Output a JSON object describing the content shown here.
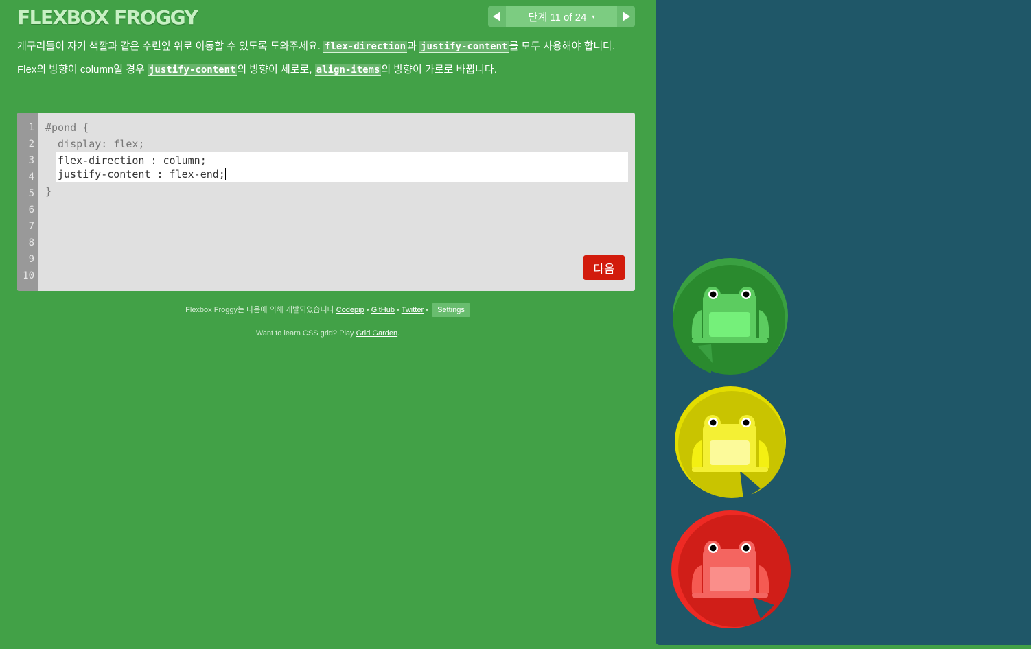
{
  "app": {
    "title": "FLEXBOX FROGGY"
  },
  "level_nav": {
    "label": "단계 11 of 24",
    "caret": "▾",
    "prev_icon": "triangle-left-icon",
    "next_icon": "triangle-right-icon"
  },
  "instructions": {
    "p1_a": "개구리들이 자기 색깔과 같은 수련잎 위로 이동할 수 있도록 도와주세요. ",
    "p1_code1": "flex-direction",
    "p1_b": "과 ",
    "p1_code2": "justify-content",
    "p1_c": "를 모두 사용해야 합니다.",
    "p2_a": "Flex의 방향이 column일 경우 ",
    "p2_code1": "justify-content",
    "p2_b": "의 방향이 세로로, ",
    "p2_code2": "align-items",
    "p2_c": "의 방향이 가로로 바뀝니다."
  },
  "editor": {
    "line_numbers": [
      "1",
      "2",
      "3",
      "4",
      "5",
      "6",
      "7",
      "8",
      "9",
      "10"
    ],
    "line1": "#pond {",
    "line2": "  display: flex;",
    "input_line1": "flex-direction : column;",
    "input_line2": "justify-content : flex-end;",
    "closing": "}",
    "next_button": "다음"
  },
  "credits": {
    "prefix": "Flexbox Froggy는 다음에 의해 개발되었습니다 ",
    "codepip": "Codepip",
    "sep": " • ",
    "github": "GitHub",
    "twitter": "Twitter",
    "settings": "Settings",
    "promo_prefix": "Want to learn CSS grid? Play ",
    "grid_garden": "Grid Garden",
    "promo_suffix": "."
  },
  "colors": {
    "background_green": "#42a147",
    "pond_blue": "#1f5768",
    "next_button_red": "#d21b0c",
    "green_pad": "#2a8a2e",
    "yellow_pad": "#c9c400",
    "red_pad": "#d01e18"
  },
  "pond": {
    "items": [
      {
        "color": "green",
        "frog_icon": "green-frog-icon",
        "pad_icon": "green-lilypad-icon"
      },
      {
        "color": "yellow",
        "frog_icon": "yellow-frog-icon",
        "pad_icon": "yellow-lilypad-icon"
      },
      {
        "color": "red",
        "frog_icon": "red-frog-icon",
        "pad_icon": "red-lilypad-icon"
      }
    ]
  }
}
